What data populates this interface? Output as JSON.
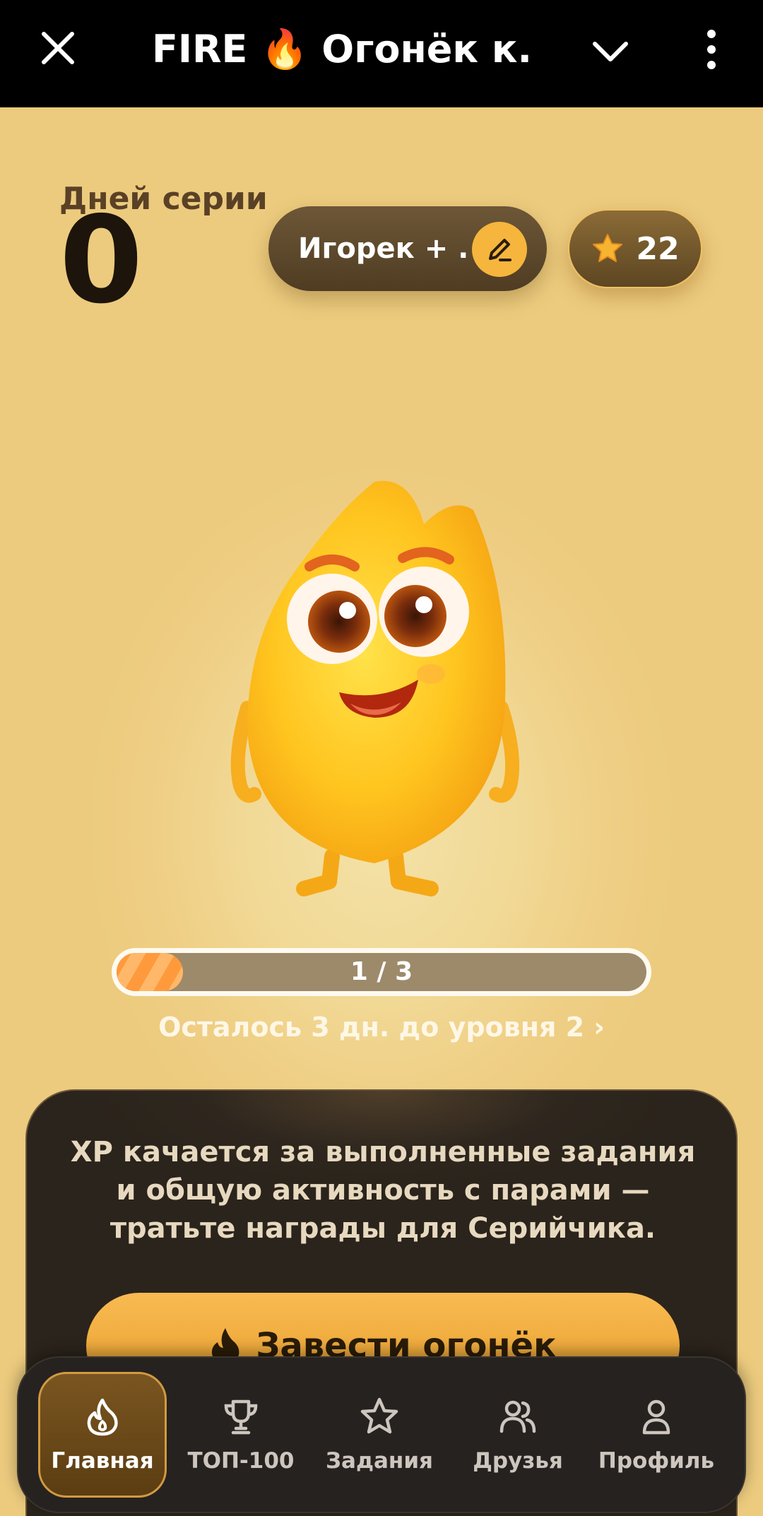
{
  "topbar": {
    "title": "FIRE 🔥 Огонёк к..."
  },
  "streak": {
    "label": "Дней серии",
    "value": "0"
  },
  "pair": {
    "name": "Игорек + ..."
  },
  "xp": {
    "value": "22"
  },
  "progress": {
    "text": "1 / 3",
    "fraction": 0.125
  },
  "level_link": "Осталось 3 дн. до уровня 2 ›",
  "info": {
    "text": "XP качается за выполненные задания и общую активность с парами — тратьте награды для Серийчика.",
    "cta_label": "Завести огонёк"
  },
  "nav": {
    "items": [
      {
        "label": "Главная"
      },
      {
        "label": "ТОП-100"
      },
      {
        "label": "Задания"
      },
      {
        "label": "Друзья"
      },
      {
        "label": "Профиль"
      }
    ]
  },
  "colors": {
    "accent": "#f6b53c",
    "card": "#2f271e",
    "nav_active": "#d29a42"
  }
}
